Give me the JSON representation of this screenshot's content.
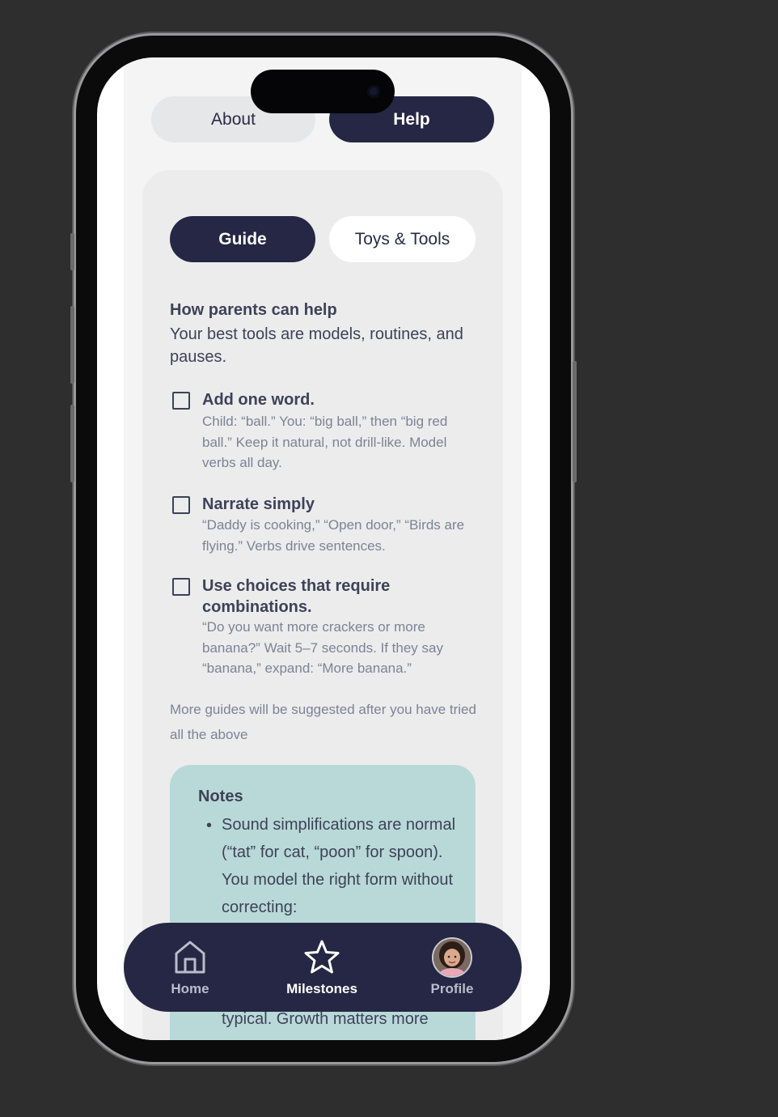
{
  "top_tabs": {
    "about": "About",
    "help": "Help",
    "active": "Help"
  },
  "sub_tabs": {
    "guide": "Guide",
    "toys_tools": "Toys & Tools",
    "active": "Guide"
  },
  "intro": {
    "title": "How parents can help",
    "text": "Your best tools are models, routines, and pauses."
  },
  "tips": [
    {
      "title": "Add one word.",
      "description": "Child: “ball.” You: “big ball,” then “big red ball.” Keep it natural, not drill-like. Model verbs all day.",
      "checked": false
    },
    {
      "title": "Narrate simply",
      "description": "“Daddy is cooking,” “Open door,” “Birds are flying.” Verbs drive sentences.",
      "checked": false
    },
    {
      "title": "Use choices that require combinations.",
      "description": "“Do you want more crackers or more banana?” Wait 5–7 seconds. If they say “banana,” expand: “More banana.”",
      "checked": false
    }
  ],
  "more_note": "More guides will be suggested after you have tried all the above",
  "notes": {
    "title": "Notes",
    "bullet": "Sound simplifications are normal (“tat” for cat, “poon” for spoon). You model the right form without correcting:",
    "tail": "typical. Growth matters more"
  },
  "bottom_nav": {
    "items": [
      {
        "label": "Home",
        "icon": "home-icon"
      },
      {
        "label": "Milestones",
        "icon": "star-icon"
      },
      {
        "label": "Profile",
        "icon": "avatar"
      }
    ],
    "active": "Milestones"
  },
  "colors": {
    "navy": "#252744",
    "card": "#ececed",
    "notes_bg": "#b9d9d8",
    "text_dark": "#3d4257",
    "text_muted": "#7e8294"
  }
}
